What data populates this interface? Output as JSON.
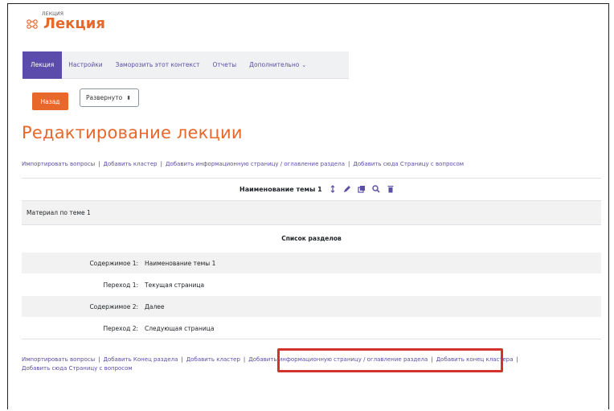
{
  "header": {
    "small_label": "ЛЕКЦИЯ",
    "title": "Лекция",
    "icon": "activity-lesson-icon"
  },
  "nav": {
    "tabs": [
      {
        "label": "Лекция",
        "active": true
      },
      {
        "label": "Настройки",
        "active": false
      },
      {
        "label": "Заморозить этот контекст",
        "active": false
      },
      {
        "label": "Отчеты",
        "active": false
      },
      {
        "label": "Дополнительно",
        "active": false
      }
    ],
    "more_chevron": "⌄"
  },
  "toolbar": {
    "back_label": "Назад",
    "view_select": "Развернуто",
    "select_arrows": "⬍"
  },
  "page_title": "Редактирование лекции",
  "top_links": {
    "import": "Импортировать вопросы",
    "add_cluster": "Добавить кластер",
    "add_info_page": "Добавить информационную страницу / оглавление раздела",
    "add_question_page": "Добавить сюда Страницу с вопросом",
    "separator": "|"
  },
  "page": {
    "title": "Наименование темы 1",
    "content": "Материал по теме 1"
  },
  "sections": {
    "title": "Список разделов",
    "rows": [
      {
        "label": "Содержимое 1:",
        "value": "Наименование темы 1"
      },
      {
        "label": "Переход 1:",
        "value": "Текущая страница"
      },
      {
        "label": "Содержимое 2:",
        "value": "Далее"
      },
      {
        "label": "Переход 2:",
        "value": "Следующая страница"
      }
    ]
  },
  "bottom_links": {
    "import": "Импортировать вопросы",
    "add_end_section": "Добавить Конец раздела",
    "add_cluster": "Добавить кластер",
    "add_info_page": "Добавить информационную страницу / оглавление раздела",
    "add_end_cluster": "Добавить конец кластера",
    "add_question_page": "Добавить сюда Страницу с вопросом",
    "separator": "|"
  },
  "colors": {
    "accent_orange": "#e8672a",
    "nav_active": "#5b4bab",
    "link": "#5a4fa5",
    "highlight": "#d1342f"
  }
}
